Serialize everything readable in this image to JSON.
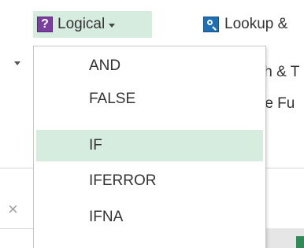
{
  "ribbon": {
    "logical_label": "Logical",
    "logical_icon": "?",
    "lookup_label": "Lookup &",
    "partial_text_1": "th & T",
    "partial_text_2": "re Fu"
  },
  "menu": {
    "items": [
      {
        "label": "AND"
      },
      {
        "label": "FALSE"
      },
      {
        "label": "IF"
      },
      {
        "label": "IFERROR"
      },
      {
        "label": "IFNA"
      }
    ],
    "highlighted": "IF"
  },
  "colors": {
    "accent_highlight": "#d6ecdf",
    "logical_icon": "#7b3fa0",
    "lookup_icon": "#1f6fb5"
  }
}
